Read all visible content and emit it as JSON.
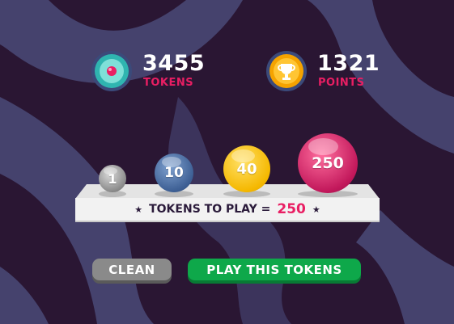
{
  "stats": {
    "tokens": {
      "value": "3455",
      "label": "TOKENS",
      "icon": "token-coin-icon"
    },
    "points": {
      "value": "1321",
      "label": "POINTS",
      "icon": "trophy-coin-icon"
    }
  },
  "chips": [
    {
      "value": "1",
      "color": "#9e9e9e"
    },
    {
      "value": "10",
      "color": "#3d5f94"
    },
    {
      "value": "40",
      "color": "#f5b800"
    },
    {
      "value": "250",
      "color": "#c2185b"
    }
  ],
  "bet": {
    "label": "TOKENS TO PLAY =",
    "amount": "250"
  },
  "buttons": {
    "clean": "CLEAN",
    "play": "PLAY THIS TOKENS"
  },
  "colors": {
    "background": "#2a1633",
    "accent": "#e91e63",
    "play_button": "#0ea84a",
    "clean_button": "#8a8a8a"
  }
}
